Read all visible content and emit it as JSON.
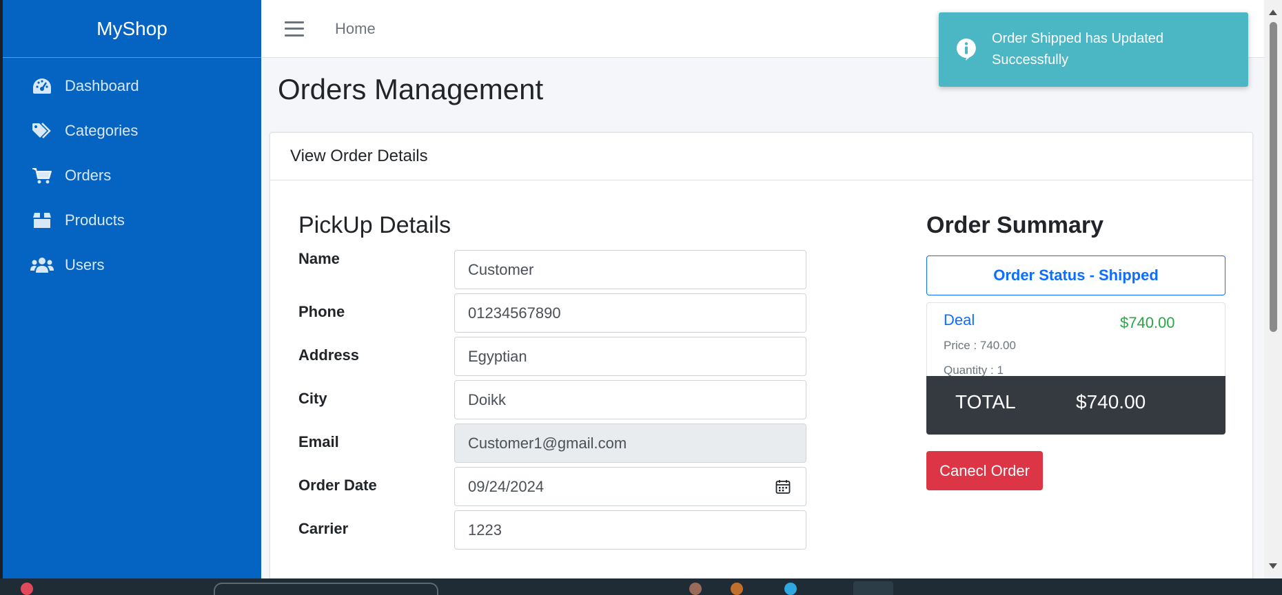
{
  "sidebar": {
    "brand": "MyShop",
    "items": [
      {
        "label": "Dashboard",
        "icon": "tachometer-icon"
      },
      {
        "label": "Categories",
        "icon": "tags-icon"
      },
      {
        "label": "Orders",
        "icon": "shopping-cart-icon"
      },
      {
        "label": "Products",
        "icon": "box-icon"
      },
      {
        "label": "Users",
        "icon": "users-icon"
      }
    ]
  },
  "topbar": {
    "home_label": "Home"
  },
  "page": {
    "title": "Orders Management",
    "card_header": "View Order Details"
  },
  "pickup": {
    "title": "PickUp Details",
    "fields": {
      "name": {
        "label": "Name",
        "value": "Customer"
      },
      "phone": {
        "label": "Phone",
        "value": "01234567890"
      },
      "address": {
        "label": "Address",
        "value": "Egyptian"
      },
      "city": {
        "label": "City",
        "value": "Doikk"
      },
      "email": {
        "label": "Email",
        "value": "Customer1@gmail.com"
      },
      "order_date": {
        "label": "Order Date",
        "value": "09/24/2024"
      },
      "carrier": {
        "label": "Carrier",
        "value": "1223"
      }
    }
  },
  "summary": {
    "title": "Order Summary",
    "status": "Order Status - Shipped",
    "item": {
      "name": "Deal",
      "price_line": "Price : 740.00",
      "quantity_line": "Quantity : 1",
      "amount": "$740.00"
    },
    "total_label": "TOTAL",
    "total_value": "$740.00",
    "cancel_label": "Canecl Order"
  },
  "toast": {
    "message": "Order Shipped has Updated Successfully",
    "icon": "info-icon"
  },
  "colors": {
    "sidebar_bg": "#0563c1",
    "toast_bg": "#4bb7c4",
    "primary": "#0d6efd",
    "success": "#28a745",
    "danger": "#dc3545",
    "dark": "#343a40"
  }
}
